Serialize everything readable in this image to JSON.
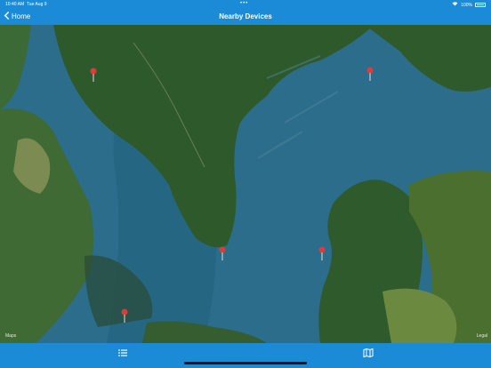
{
  "status_bar": {
    "time": "10:40 AM",
    "date": "Tue Aug 9",
    "battery": "100%"
  },
  "nav": {
    "back_label": "Home",
    "title": "Nearby Devices"
  },
  "map": {
    "legal_left": "Maps",
    "legal_right": "Legal",
    "pins": [
      {
        "name": "device-pin-1"
      },
      {
        "name": "device-pin-2"
      },
      {
        "name": "device-pin-3"
      },
      {
        "name": "device-pin-4"
      },
      {
        "name": "device-pin-5"
      }
    ]
  },
  "tabs": [
    {
      "name": "list-tab",
      "icon": "list-icon"
    },
    {
      "name": "map-tab",
      "icon": "map-icon"
    }
  ],
  "colors": {
    "bar": "#1b8bd8",
    "water": "#2b6d8a",
    "land": "#2f5a2c",
    "pin": "#e03a3a"
  }
}
